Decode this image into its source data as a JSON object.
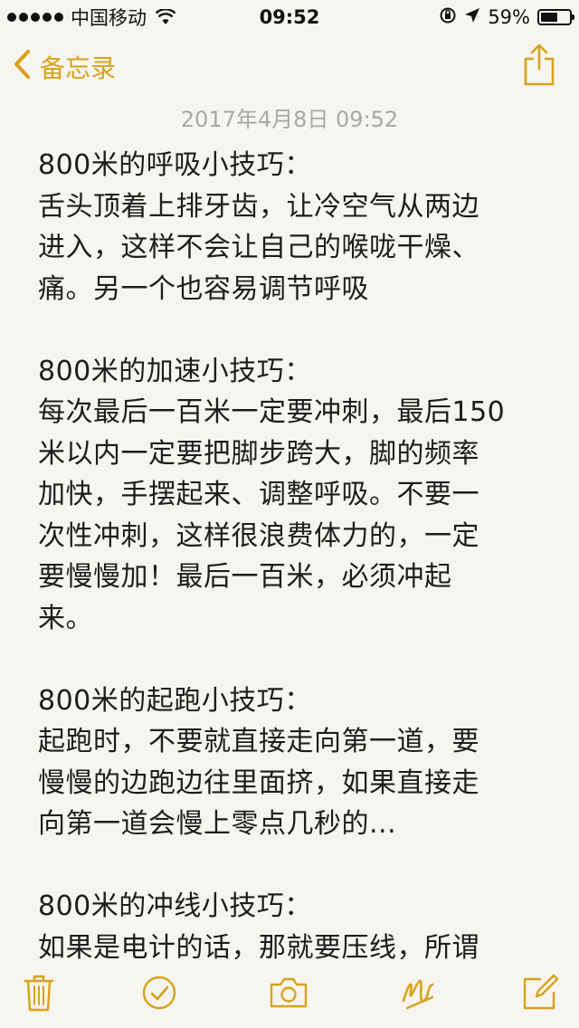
{
  "status_bar": {
    "carrier": "中国移动",
    "time": "09:52",
    "battery_percent_label": "59%",
    "battery_level": 0.59
  },
  "nav": {
    "back_label": "备忘录"
  },
  "note": {
    "date": "2017年4月8日 09:52",
    "lines": [
      "800米的呼吸小技巧：",
      "舌头顶着上排牙齿，让冷空气从两边",
      "进入，这样不会让自己的喉咙干燥、",
      "痛。另一个也容易调节呼吸",
      "",
      "800米的加速小技巧：",
      "每次最后一百米一定要冲刺，最后150",
      "米以内一定要把脚步跨大，脚的频率",
      "加快，手摆起来、调整呼吸。不要一",
      "次性冲刺，这样很浪费体力的，一定",
      "要慢慢加！最后一百米，必须冲起",
      "来。",
      "",
      "800米的起跑小技巧：",
      "起跑时，不要就直接走向第一道，要",
      "慢慢的边跑边往里面挤，如果直接走",
      "向第一道会慢上零点几秒的...",
      "",
      "800米的冲线小技巧：",
      "如果是电计的话，那就要压线，所谓"
    ]
  },
  "colors": {
    "accent": "#d7a21b",
    "background": "#f7f5ef",
    "date_text": "#a8a8a6"
  },
  "toolbar": {
    "icons": [
      "trash-icon",
      "checklist-icon",
      "camera-icon",
      "sketch-icon",
      "compose-icon"
    ]
  }
}
